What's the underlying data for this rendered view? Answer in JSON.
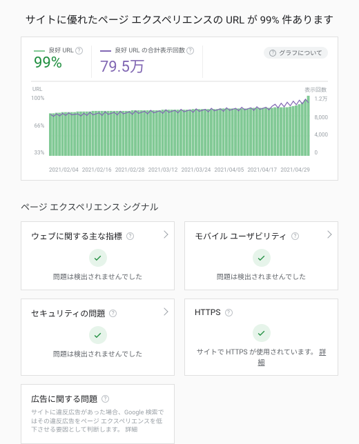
{
  "title": "サイトに優れたページ エクスペリエンスの URL が 99% 件あります",
  "chart": {
    "metric1_caption": "良好 URL",
    "metric1_value": "99%",
    "metric2_caption": "良好 URL の合計表示回数",
    "metric2_value": "79.5万",
    "about_label": "グラフについて",
    "left_axis_label": "URL",
    "right_axis_label": "表示回数",
    "y_left_ticks": [
      "100%",
      "66%",
      "33%"
    ],
    "y_right_ticks": [
      "1.2万",
      "8,000",
      "4,000",
      "0"
    ],
    "x_ticks": [
      "2021/02/04",
      "2021/02/16",
      "2021/02/28",
      "2021/03/12",
      "2021/03/24",
      "2021/04/05",
      "2021/04/17",
      "2021/04/29"
    ]
  },
  "section_title": "ページ エクスペリエンス シグナル",
  "cards": {
    "cwv": {
      "title": "ウェブに関する主な指標",
      "status": "問題は検出されませんでした"
    },
    "mobile": {
      "title": "モバイル ユーザビリティ",
      "status": "問題は検出されませんでした"
    },
    "security": {
      "title": "セキュリティの問題",
      "status": "問題は検出されませんでした"
    },
    "https": {
      "title": "HTTPS",
      "status_prefix": "サイトで HTTPS が使用されています。",
      "link": "詳細"
    },
    "ads": {
      "title": "広告に関する問題",
      "desc_prefix": "サイトに違反広告があった場合、Google 検索ではその違反広告をページ エクスペリエンスを低下させる要因として判断します。",
      "link": "詳細"
    }
  },
  "chart_data": {
    "type": "bar+line",
    "x": [
      "2021/02/04",
      "2021/02/16",
      "2021/02/28",
      "2021/03/12",
      "2021/03/24",
      "2021/04/05",
      "2021/04/17",
      "2021/04/29"
    ],
    "series": [
      {
        "name": "良好 URL (%)",
        "type": "bar",
        "color": "#81c995",
        "yaxis": "left",
        "values_pct": [
          70,
          70,
          71,
          71,
          72,
          72,
          72,
          72,
          72,
          73,
          73,
          73,
          73,
          73,
          74,
          74,
          74,
          74,
          74,
          74,
          74,
          74,
          74,
          74,
          74,
          74,
          74,
          75,
          75,
          75,
          75,
          75,
          75,
          75,
          75,
          75,
          75,
          76,
          76,
          76,
          76,
          76,
          76,
          76,
          76,
          76,
          76,
          77,
          77,
          77,
          77,
          77,
          77,
          77,
          77,
          77,
          78,
          78,
          78,
          78,
          78,
          78,
          78,
          78,
          78,
          78,
          79,
          79,
          79,
          79,
          79,
          79,
          79,
          79,
          80,
          80,
          80,
          80,
          80,
          81,
          82,
          83,
          85,
          88,
          92,
          99
        ]
      },
      {
        "name": "表示回数",
        "type": "line",
        "color": "#8167b3",
        "yaxis": "right",
        "values": [
          8200,
          7800,
          8300,
          7900,
          8400,
          8000,
          8500,
          8100,
          8200,
          8300,
          7900,
          8400,
          8000,
          8600,
          8100,
          8300,
          8500,
          8000,
          8700,
          8200,
          8400,
          8600,
          8100,
          8800,
          8300,
          8500,
          8700,
          8200,
          8900,
          8400,
          8600,
          8800,
          8300,
          9000,
          8500,
          8700,
          8900,
          8400,
          9100,
          8600,
          8800,
          9000,
          8500,
          9200,
          8700,
          8900,
          9100,
          8600,
          9300,
          8800,
          9000,
          9200,
          8700,
          9400,
          8900,
          9100,
          9300,
          8800,
          9500,
          9000,
          9200,
          9400,
          8900,
          9600,
          9100,
          9300,
          9500,
          9000,
          9700,
          9200,
          9400,
          9600,
          9100,
          9800,
          10200,
          9500,
          10400,
          9700,
          10600,
          9900,
          10800,
          10100,
          11000,
          10300,
          11200,
          10500
        ]
      }
    ],
    "y_left": {
      "label": "URL",
      "range": [
        0,
        100
      ],
      "unit": "%"
    },
    "y_right": {
      "label": "表示回数",
      "range": [
        0,
        12000
      ]
    }
  }
}
